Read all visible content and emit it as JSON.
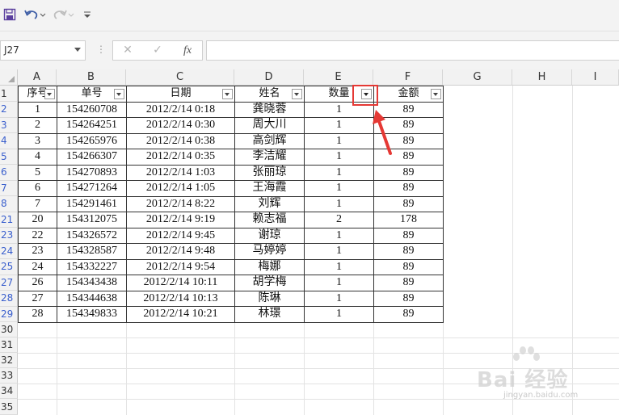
{
  "toolbar": {
    "save_icon": "save-icon",
    "undo_icon": "undo-icon",
    "redo_icon": "redo-icon",
    "customize_icon": "customize-toolbar-icon"
  },
  "formula_bar": {
    "name_box": "J27",
    "separator": "⋮",
    "cancel": "✕",
    "confirm": "✓",
    "fx": "fx",
    "formula": ""
  },
  "columns": [
    "A",
    "B",
    "C",
    "D",
    "E",
    "F",
    "G",
    "H",
    "I"
  ],
  "row_numbers": [
    "1",
    "2",
    "3",
    "4",
    "5",
    "6",
    "7",
    "8",
    "21",
    "23",
    "24",
    "25",
    "27",
    "28",
    "29",
    "30",
    "31",
    "32",
    "33",
    "34",
    "35"
  ],
  "table": {
    "headers": [
      "序号",
      "单号",
      "日期",
      "姓名",
      "数量",
      "金额"
    ],
    "rows": [
      [
        "1",
        "154260708",
        "2012/2/14  0:18",
        "龚晓蓉",
        "1",
        "89"
      ],
      [
        "2",
        "154264251",
        "2012/2/14  0:30",
        "周大川",
        "1",
        "89"
      ],
      [
        "3",
        "154265976",
        "2012/2/14  0:38",
        "高剑辉",
        "1",
        "89"
      ],
      [
        "4",
        "154266307",
        "2012/2/14  0:35",
        "李洁耀",
        "1",
        "89"
      ],
      [
        "5",
        "154270893",
        "2012/2/14  1:03",
        "张丽琼",
        "1",
        "89"
      ],
      [
        "6",
        "154271264",
        "2012/2/14  1:05",
        "王海霞",
        "1",
        "89"
      ],
      [
        "7",
        "154291461",
        "2012/2/14  8:22",
        "刘辉",
        "1",
        "89"
      ],
      [
        "20",
        "154312075",
        "2012/2/14  9:19",
        "赖志福",
        "2",
        "178"
      ],
      [
        "22",
        "154326572",
        "2012/2/14  9:45",
        "谢琼",
        "1",
        "89"
      ],
      [
        "23",
        "154328587",
        "2012/2/14  9:48",
        "马婷婷",
        "1",
        "89"
      ],
      [
        "24",
        "154332227",
        "2012/2/14  9:54",
        "梅娜",
        "1",
        "89"
      ],
      [
        "26",
        "154343438",
        "2012/2/14  10:11",
        "胡学梅",
        "1",
        "89"
      ],
      [
        "27",
        "154344638",
        "2012/2/14  10:13",
        "陈琳",
        "1",
        "89"
      ],
      [
        "28",
        "154349833",
        "2012/2/14  10:21",
        "林璟",
        "1",
        "89"
      ]
    ]
  },
  "filtered_column": "数量",
  "colors": {
    "highlight": "#e53935",
    "row_number_filtered": "#3a5fcd",
    "arrow": "#e53935"
  },
  "watermark": {
    "text": "Bai 经验",
    "sub": "jingyan.baidu.com"
  }
}
